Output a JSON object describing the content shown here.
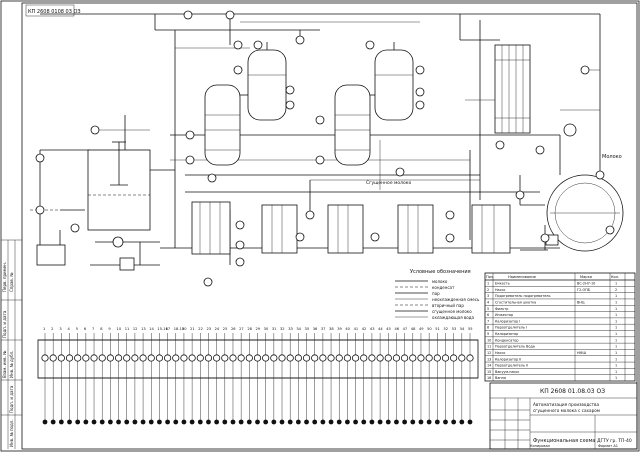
{
  "drawing": {
    "corner_stamp": "КП 2608 0108 03 ОЗ",
    "stamp_number": "КП 2608 01.08.03 ОЗ",
    "stamp_title_1": "Автоматизация производства",
    "stamp_title_2": "сгущенного молока с сахаром",
    "stamp_sheet_name": "Функциональная схема",
    "stamp_org": "ДГТУ гр. ТП-40",
    "stamp_format": "Формат А1",
    "stamp_copy": "Копировал",
    "side_labels": [
      "Перв. примен.",
      "Справ. №",
      "Подп. и дата",
      "Инв. № дубл.",
      "Взам. инв. №",
      "Подп. и дата",
      "Инв. № подл."
    ],
    "legend_title": "Условные обозначения",
    "legend_items": [
      "молоко",
      "конденсат",
      "пар",
      "неохлажденная смесь",
      "вторичный пар",
      "сгущенное молоко",
      "охлаждающая вода"
    ],
    "label_dense": "Сгущенное молоко",
    "label_right": "Молоко"
  },
  "table": {
    "headers": [
      "Поз.",
      "Наименование",
      "Марка",
      "Кол."
    ],
    "rows": [
      {
        "pos": "1",
        "name": "Емкость",
        "mark": "ВС-2Н7-10",
        "qty": "1"
      },
      {
        "pos": "2",
        "name": "Насос",
        "mark": "Г2-ОПБ",
        "qty": "2"
      },
      {
        "pos": "3",
        "name": "Подогреватель подогреватель",
        "mark": "",
        "qty": "1"
      },
      {
        "pos": "4",
        "name": "Сгустительная шкатка",
        "mark": "ВНЦ",
        "qty": "1"
      },
      {
        "pos": "5",
        "name": "Фильтр",
        "mark": "",
        "qty": "1"
      },
      {
        "pos": "6",
        "name": "Инжектор",
        "mark": "",
        "qty": "1"
      },
      {
        "pos": "7",
        "name": "Калоризатор I",
        "mark": "",
        "qty": "1"
      },
      {
        "pos": "8",
        "name": "Пароотделитель I",
        "mark": "",
        "qty": "1"
      },
      {
        "pos": "9",
        "name": "Калоризатор",
        "mark": "",
        "qty": "1"
      },
      {
        "pos": "10",
        "name": "Конденсатор",
        "mark": "",
        "qty": "1"
      },
      {
        "pos": "11",
        "name": "Пароотделитель Вода",
        "mark": "",
        "qty": "1"
      },
      {
        "pos": "12",
        "name": "Насос",
        "mark": "НМШ",
        "qty": "1"
      },
      {
        "pos": "13",
        "name": "Калоризатор II",
        "mark": "",
        "qty": "1"
      },
      {
        "pos": "14",
        "name": "Пароотделитель II",
        "mark": "",
        "qty": "1"
      },
      {
        "pos": "15",
        "name": "Вакуум-насос",
        "mark": "",
        "qty": "1"
      },
      {
        "pos": "16",
        "name": "Ванна",
        "mark": "",
        "qty": "1"
      }
    ]
  },
  "bus": {
    "labels": [
      "1",
      "2",
      "3",
      "4",
      "5",
      "6",
      "7",
      "8",
      "9",
      "10",
      "11",
      "12",
      "13",
      "14",
      "15-16",
      "17",
      "18-19",
      "20",
      "21",
      "22",
      "23",
      "24",
      "25",
      "26",
      "27",
      "28",
      "29",
      "30",
      "31",
      "32",
      "33",
      "34",
      "35",
      "36",
      "37",
      "38",
      "39",
      "40",
      "41",
      "42",
      "43",
      "44",
      "45",
      "46",
      "47",
      "48",
      "49",
      "50",
      "51",
      "52",
      "53",
      "54",
      "55"
    ]
  }
}
